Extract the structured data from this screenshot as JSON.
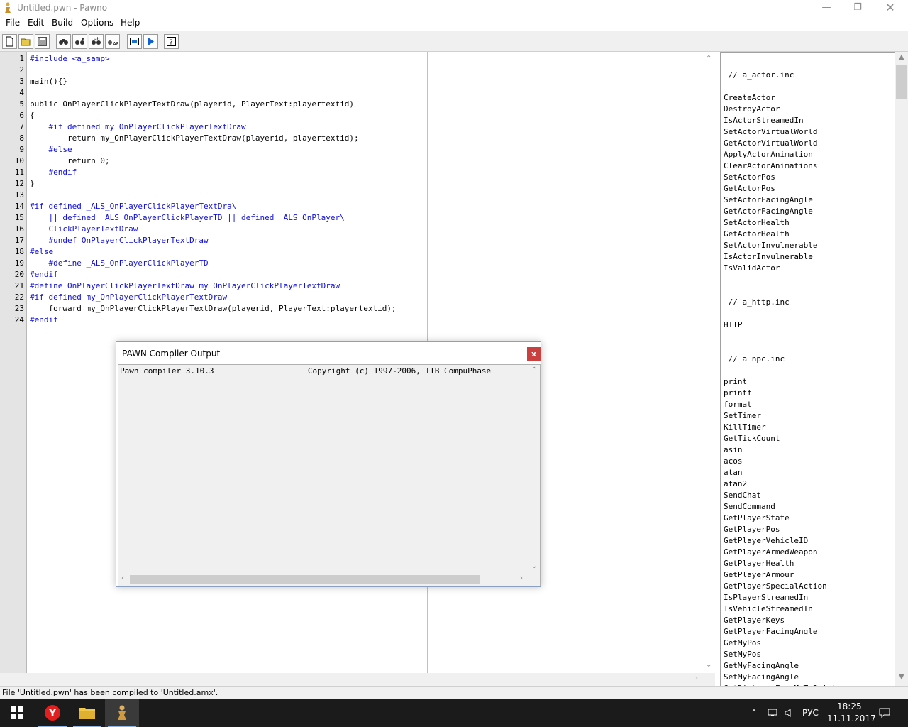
{
  "window": {
    "title": "Untitled.pwn - Pawno"
  },
  "menu": [
    "File",
    "Edit",
    "Build",
    "Options",
    "Help"
  ],
  "toolbar": {
    "icons": [
      "new-file-icon",
      "open-folder-icon",
      "save-icon",
      "find-icon",
      "find-next-icon",
      "replace-icon",
      "goto-line-icon",
      "compile-icon",
      "run-icon",
      "help-icon"
    ]
  },
  "editor": {
    "line_numbers": [
      "1",
      "2",
      "3",
      "4",
      "5",
      "6",
      "7",
      "8",
      "9",
      "10",
      "11",
      "12",
      "13",
      "14",
      "15",
      "16",
      "17",
      "18",
      "19",
      "20",
      "21",
      "22",
      "23",
      "24"
    ],
    "lines": [
      "#include <a_samp>",
      "",
      "main(){}",
      "",
      "public OnPlayerClickPlayerTextDraw(playerid, PlayerText:playertextid)",
      "{",
      "    #if defined my_OnPlayerClickPlayerTextDraw",
      "        return my_OnPlayerClickPlayerTextDraw(playerid, playertextid);",
      "    #else",
      "        return 0;",
      "    #endif",
      "}",
      "",
      "#if defined _ALS_OnPlayerClickPlayerTextDra\\",
      "    || defined _ALS_OnPlayerClickPlayerTD || defined _ALS_OnPlayer\\",
      "    ClickPlayerTextDraw",
      "    #undef OnPlayerClickPlayerTextDraw",
      "#else",
      "    #define _ALS_OnPlayerClickPlayerTD",
      "#endif",
      "#define OnPlayerClickPlayerTextDraw my_OnPlayerClickPlayerTextDraw",
      "#if defined my_OnPlayerClickPlayerTextDraw",
      "    forward my_OnPlayerClickPlayerTextDraw(playerid, PlayerText:playertextid);",
      "#endif"
    ],
    "line_colors": [
      "kw",
      "pl",
      "pl",
      "pl",
      "pl",
      "pl",
      "kw",
      "pl",
      "kw",
      "pl",
      "kw",
      "pl",
      "pl",
      "kw",
      "kw",
      "kw",
      "kw",
      "kw",
      "kw",
      "kw",
      "kw",
      "kw",
      "pl",
      "kw"
    ]
  },
  "function_list": {
    "items": [
      "",
      " // a_actor.inc",
      "",
      "CreateActor",
      "DestroyActor",
      "IsActorStreamedIn",
      "SetActorVirtualWorld",
      "GetActorVirtualWorld",
      "ApplyActorAnimation",
      "ClearActorAnimations",
      "SetActorPos",
      "GetActorPos",
      "SetActorFacingAngle",
      "GetActorFacingAngle",
      "SetActorHealth",
      "GetActorHealth",
      "SetActorInvulnerable",
      "IsActorInvulnerable",
      "IsValidActor",
      "",
      "",
      " // a_http.inc",
      "",
      "HTTP",
      "",
      "",
      " // a_npc.inc",
      "",
      "print",
      "printf",
      "format",
      "SetTimer",
      "KillTimer",
      "GetTickCount",
      "asin",
      "acos",
      "atan",
      "atan2",
      "SendChat",
      "SendCommand",
      "GetPlayerState",
      "GetPlayerPos",
      "GetPlayerVehicleID",
      "GetPlayerArmedWeapon",
      "GetPlayerHealth",
      "GetPlayerArmour",
      "GetPlayerSpecialAction",
      "IsPlayerStreamedIn",
      "IsVehicleStreamedIn",
      "GetPlayerKeys",
      "GetPlayerFacingAngle",
      "GetMyPos",
      "SetMyPos",
      "GetMyFacingAngle",
      "SetMyFacingAngle",
      "GetDistanceFromMeToPoint"
    ]
  },
  "status": {
    "text": "File 'Untitled.pwn' has been compiled to 'Untitled.amx'."
  },
  "compiler_dialog": {
    "title": "PAWN Compiler Output",
    "close_label": "x",
    "output": "Pawn compiler 3.10.3                    Copyright (c) 1997-2006, ITB CompuPhase"
  },
  "taskbar": {
    "apps": [
      "start-icon",
      "yandex-browser-icon",
      "file-explorer-icon",
      "pawno-icon"
    ],
    "language": "РУС",
    "time": "18:25",
    "date": "11.11.2017"
  }
}
